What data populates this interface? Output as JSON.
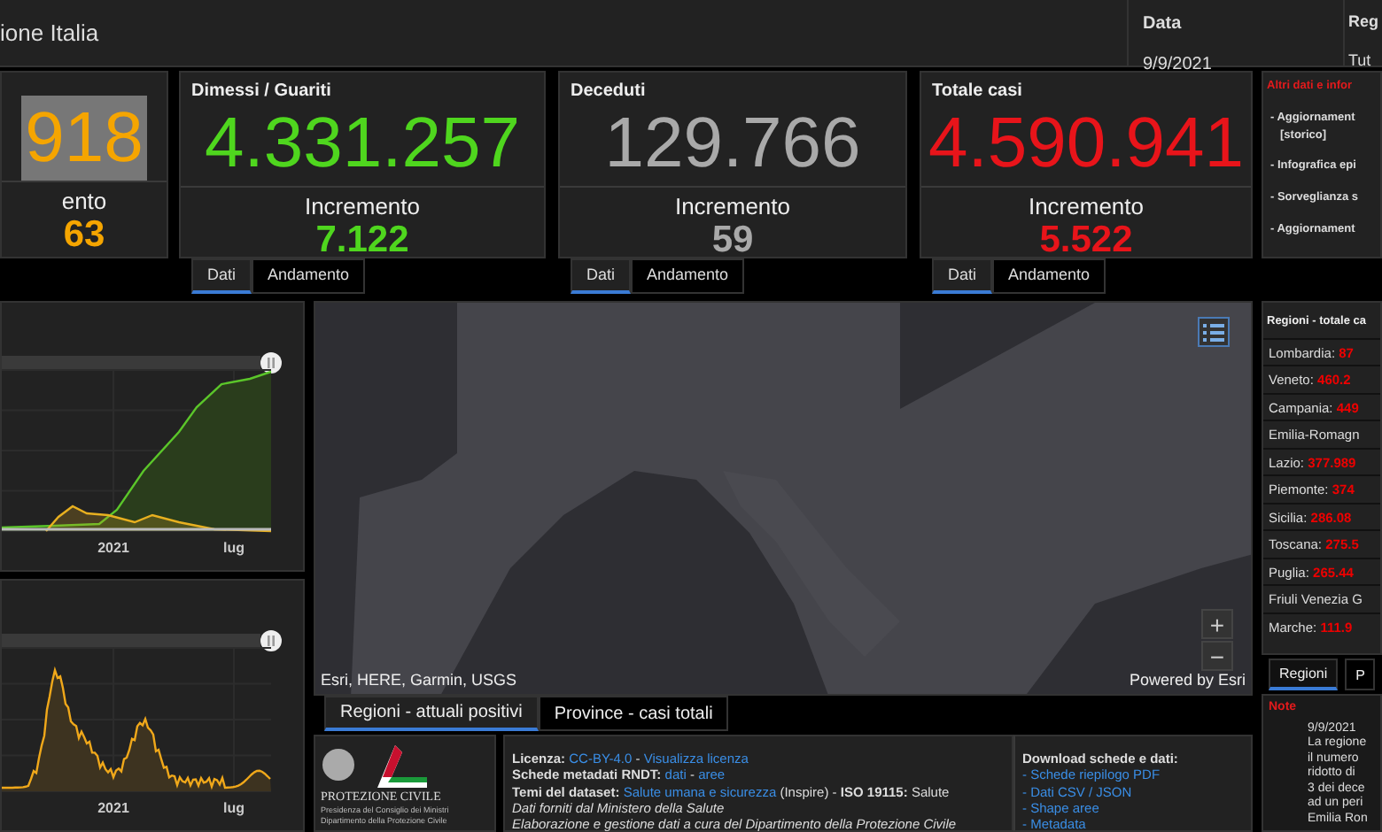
{
  "header": {
    "title": "ione Italia",
    "fields": [
      {
        "label": "Data",
        "value": "9/9/2021"
      },
      {
        "label": "Reg",
        "value": "Tut"
      }
    ]
  },
  "stat_cards": [
    {
      "value": "918",
      "color": "#f5a500",
      "highlighted": true,
      "increment_label": "ento",
      "increment": "63"
    },
    {
      "title": "Dimessi / Guariti",
      "value": "4.331.257",
      "color": "#4fd61e",
      "highlighted": false,
      "increment_label": "Incremento",
      "increment": "7.122",
      "tabs": [
        {
          "label": "Dati",
          "selected": true
        },
        {
          "label": "Andamento",
          "selected": false
        }
      ]
    },
    {
      "title": "Deceduti",
      "value": "129.766",
      "color": "#a9a9a9",
      "highlighted": false,
      "increment_label": "Incremento",
      "increment": "59",
      "tabs": [
        {
          "label": "Dati",
          "selected": true
        },
        {
          "label": "Andamento",
          "selected": false
        }
      ]
    },
    {
      "title": "Totale casi",
      "value": "4.590.941",
      "color": "#e8141a",
      "highlighted": false,
      "increment_label": "Incremento",
      "increment": "5.522",
      "tabs": [
        {
          "label": "Dati",
          "selected": true
        },
        {
          "label": "Andamento",
          "selected": false
        }
      ]
    }
  ],
  "side_links": {
    "title": "Altri dati e infor",
    "items": [
      {
        "text": "- Aggiornament",
        "sub": "[storico]"
      },
      {
        "text": "- Infografica epi"
      },
      {
        "text": "- Sorveglianza s"
      },
      {
        "text": "- Aggiornament"
      }
    ]
  },
  "charts": [
    {
      "kind": "lines",
      "ticks": [
        "2021",
        "lug"
      ]
    },
    {
      "kind": "area",
      "ticks": [
        "2021",
        "lug"
      ]
    }
  ],
  "map": {
    "attribution": "Esri, HERE, Garmin, USGS",
    "powered_by": "Powered by Esri",
    "zoom_in": "+",
    "zoom_out": "−"
  },
  "map_tabs": [
    {
      "label": "Regioni - attuali positivi",
      "selected": true
    },
    {
      "label": "Province - casi totali",
      "selected": false
    }
  ],
  "footer": {
    "logo": {
      "name": "PROTEZIONE CIVILE",
      "lines": [
        "Presidenza del Consiglio dei Ministri",
        "Dipartimento della Protezione Civile"
      ]
    },
    "info_lines": [
      [
        {
          "kind": "bold",
          "text": "Licenza:"
        },
        {
          "kind": "link",
          "text": "CC-BY-4.0"
        },
        {
          "kind": "plain",
          "text": "-"
        },
        {
          "kind": "link",
          "text": "Visualizza licenza"
        }
      ],
      [
        {
          "kind": "bold",
          "text": "Schede metadati RNDT:"
        },
        {
          "kind": "link",
          "text": "dati"
        },
        {
          "kind": "plain",
          "text": "-"
        },
        {
          "kind": "link",
          "text": "aree"
        }
      ],
      [
        {
          "kind": "bold",
          "text": "Temi del dataset:"
        },
        {
          "kind": "link",
          "text": "Salute umana e sicurezza"
        },
        {
          "kind": "plain",
          "text": "(Inspire) -"
        },
        {
          "kind": "bold",
          "text": "ISO 19115:"
        },
        {
          "kind": "plain",
          "text": "Salute"
        }
      ],
      [
        {
          "kind": "italic",
          "text": "Dati forniti dal Ministero della Salute"
        }
      ],
      [
        {
          "kind": "italic",
          "text": "Elaborazione e gestione dati a cura del Dipartimento della Protezione Civile"
        }
      ]
    ],
    "downloads": {
      "title": "Download schede e dati:",
      "links": [
        "- Schede riepilogo PDF",
        "- Dati CSV / JSON",
        "- Shape aree",
        "- Metadata"
      ]
    }
  },
  "regions": {
    "title": "Regioni - totale ca",
    "rows": [
      {
        "name": "Lombardia:",
        "value": "87"
      },
      {
        "name": "Veneto:",
        "value": "460.2"
      },
      {
        "name": "Campania:",
        "value": "449"
      },
      {
        "name": "Emilia-Romagn"
      },
      {
        "name": "Lazio:",
        "value": "377.989"
      },
      {
        "name": "Piemonte:",
        "value": "374"
      },
      {
        "name": "Sicilia:",
        "value": "286.08"
      },
      {
        "name": "Toscana:",
        "value": "275.5"
      },
      {
        "name": "Puglia:",
        "value": "265.44"
      },
      {
        "name": "Friuli Venezia G"
      },
      {
        "name": "Marche:",
        "value": "111.9"
      }
    ],
    "tabs": [
      {
        "label": "Regioni",
        "selected": true
      },
      {
        "label": "P",
        "selected": false
      }
    ]
  },
  "note": {
    "title": "Note",
    "date": "9/9/2021",
    "lines": [
      "La regione",
      "il numero",
      "ridotto di",
      "3 dei dece",
      "ad un peri",
      "Emilia Ron"
    ]
  }
}
